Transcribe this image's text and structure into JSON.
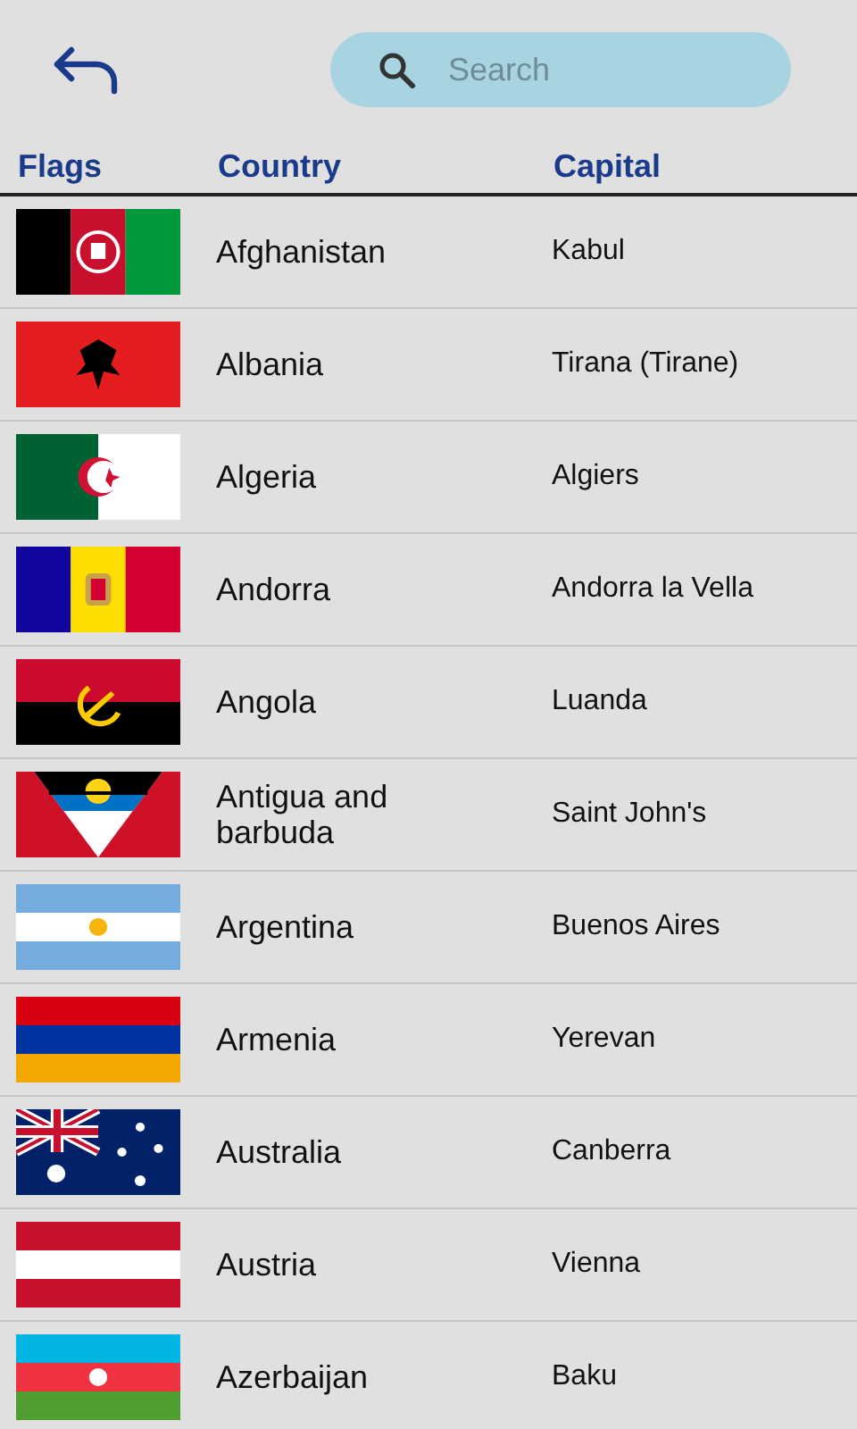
{
  "search": {
    "placeholder": "Search"
  },
  "columns": [
    "Flags",
    "Country",
    "Capital"
  ],
  "rows": [
    {
      "country": "Afghanistan",
      "capital": "Kabul"
    },
    {
      "country": "Albania",
      "capital": "Tirana (Tirane)"
    },
    {
      "country": "Algeria",
      "capital": "Algiers"
    },
    {
      "country": "Andorra",
      "capital": "Andorra la Vella"
    },
    {
      "country": "Angola",
      "capital": "Luanda"
    },
    {
      "country": "Antigua and barbuda",
      "capital": "Saint John's"
    },
    {
      "country": "Argentina",
      "capital": "Buenos Aires"
    },
    {
      "country": "Armenia",
      "capital": "Yerevan"
    },
    {
      "country": "Australia",
      "capital": "Canberra"
    },
    {
      "country": "Austria",
      "capital": "Vienna"
    },
    {
      "country": "Azerbaijan",
      "capital": "Baku"
    }
  ]
}
